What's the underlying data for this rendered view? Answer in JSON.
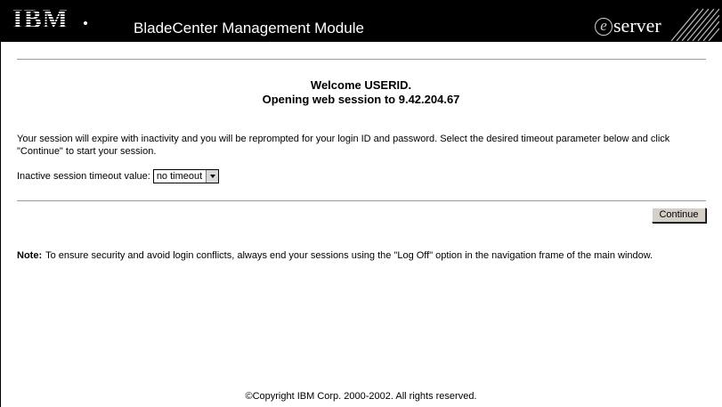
{
  "header": {
    "logo_text": "IBM",
    "app_title": "BladeCenter Management Module",
    "eserver_e": "e",
    "eserver_text": "server"
  },
  "welcome": {
    "line1": "Welcome USERID.",
    "line2": "Opening web session to 9.42.204.67"
  },
  "session": {
    "message": "Your session will expire with inactivity and you will be reprompted for your login ID and password. Select the desired timeout parameter below and click \"Continue\" to start your session.",
    "timeout_label": "Inactive session timeout value:",
    "timeout_selected": "no timeout"
  },
  "actions": {
    "continue_label": "Continue"
  },
  "note": {
    "label": "Note:",
    "text": "To ensure security and avoid login conflicts, always end your sessions using the \"Log Off\" option in the navigation frame of the main window."
  },
  "footer": {
    "copyright": "©Copyright IBM Corp. 2000-2002. All rights reserved."
  },
  "colors": {
    "header_bg": "#000000",
    "button_face": "#d4d0c8",
    "rule": "#9a9a9a"
  },
  "icons": {
    "brand_logo": "ibm-logo",
    "eserver_logo": "eserver-logo",
    "header_decoration": "diagonal-stripes-icon",
    "select_arrow": "chevron-down-icon"
  }
}
